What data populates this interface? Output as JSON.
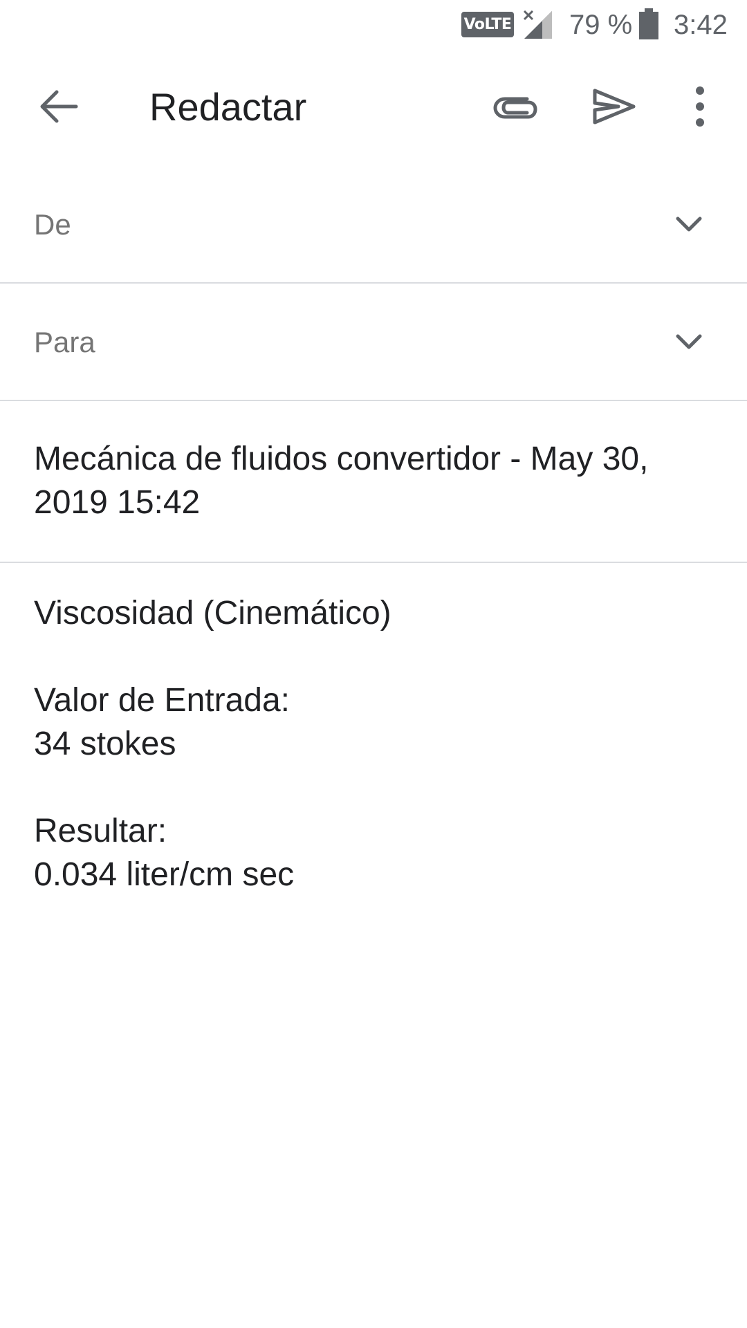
{
  "status_bar": {
    "volte_label": "VoLTE",
    "signal_icon": "signal-no-data-icon",
    "battery_percent": "79 %",
    "battery_icon": "battery-icon",
    "time": "3:42"
  },
  "toolbar": {
    "back_icon": "arrow-back-icon",
    "title": "Redactar",
    "attach_icon": "paperclip-icon",
    "send_icon": "send-icon",
    "more_icon": "more-vert-icon"
  },
  "compose": {
    "from_label": "De",
    "to_label": "Para",
    "chevron_icon": "chevron-down-icon",
    "subject": "Mecánica de fluidos convertidor - May 30, 2019 15:42",
    "body_lines": [
      "Viscosidad (Cinemático)",
      "",
      "Valor de Entrada:",
      "34 stokes",
      "",
      "Resultar:",
      "0.034 liter/cm sec"
    ]
  },
  "colors": {
    "text_primary": "#202124",
    "text_secondary": "#757575",
    "icon": "#5f6368",
    "divider": "#dadce0",
    "background": "#ffffff"
  }
}
